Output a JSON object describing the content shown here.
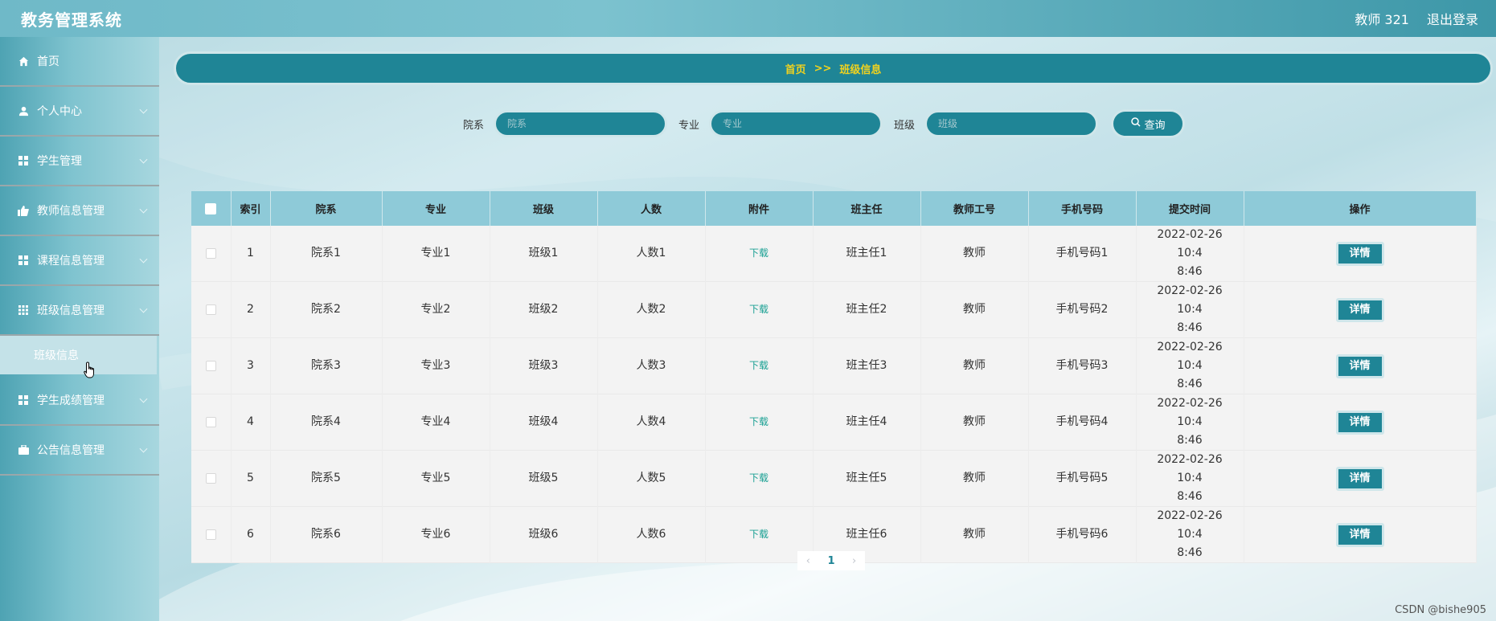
{
  "app": {
    "title": "教务管理系统"
  },
  "header": {
    "user_label": "教师 321",
    "logout_label": "退出登录"
  },
  "sidebar": {
    "items": [
      {
        "label": "首页",
        "icon": "home-icon",
        "expandable": false
      },
      {
        "label": "个人中心",
        "icon": "user-icon",
        "expandable": true
      },
      {
        "label": "学生管理",
        "icon": "grid-icon",
        "expandable": true
      },
      {
        "label": "教师信息管理",
        "icon": "thumbs-up-icon",
        "expandable": true
      },
      {
        "label": "课程信息管理",
        "icon": "grid-icon",
        "expandable": true
      },
      {
        "label": "班级信息管理",
        "icon": "table-icon",
        "expandable": true,
        "expanded": true
      },
      {
        "label": "学生成绩管理",
        "icon": "grid-icon",
        "expandable": true
      },
      {
        "label": "公告信息管理",
        "icon": "briefcase-icon",
        "expandable": true
      }
    ],
    "submenu": {
      "label": "班级信息"
    }
  },
  "breadcrumb": {
    "home": "首页",
    "separator": ">>",
    "current": "班级信息"
  },
  "search": {
    "dept_label": "院系",
    "dept_placeholder": "院系",
    "major_label": "专业",
    "major_placeholder": "专业",
    "class_label": "班级",
    "class_placeholder": "班级",
    "query_label": "查询"
  },
  "table": {
    "headers": [
      "索引",
      "院系",
      "专业",
      "班级",
      "人数",
      "附件",
      "班主任",
      "教师工号",
      "手机号码",
      "提交时间",
      "操作"
    ],
    "rows": [
      {
        "index": "1",
        "dept": "院系1",
        "major": "专业1",
        "class": "班级1",
        "count": "人数1",
        "attachment": "下载",
        "head_teacher": "班主任1",
        "teacher_id": "教师",
        "phone": "手机号码1",
        "time_line1": "2022-02-26 10:4",
        "time_line2": "8:46",
        "action": "详情"
      },
      {
        "index": "2",
        "dept": "院系2",
        "major": "专业2",
        "class": "班级2",
        "count": "人数2",
        "attachment": "下载",
        "head_teacher": "班主任2",
        "teacher_id": "教师",
        "phone": "手机号码2",
        "time_line1": "2022-02-26 10:4",
        "time_line2": "8:46",
        "action": "详情"
      },
      {
        "index": "3",
        "dept": "院系3",
        "major": "专业3",
        "class": "班级3",
        "count": "人数3",
        "attachment": "下载",
        "head_teacher": "班主任3",
        "teacher_id": "教师",
        "phone": "手机号码3",
        "time_line1": "2022-02-26 10:4",
        "time_line2": "8:46",
        "action": "详情"
      },
      {
        "index": "4",
        "dept": "院系4",
        "major": "专业4",
        "class": "班级4",
        "count": "人数4",
        "attachment": "下载",
        "head_teacher": "班主任4",
        "teacher_id": "教师",
        "phone": "手机号码4",
        "time_line1": "2022-02-26 10:4",
        "time_line2": "8:46",
        "action": "详情"
      },
      {
        "index": "5",
        "dept": "院系5",
        "major": "专业5",
        "class": "班级5",
        "count": "人数5",
        "attachment": "下载",
        "head_teacher": "班主任5",
        "teacher_id": "教师",
        "phone": "手机号码5",
        "time_line1": "2022-02-26 10:4",
        "time_line2": "8:46",
        "action": "详情"
      },
      {
        "index": "6",
        "dept": "院系6",
        "major": "专业6",
        "class": "班级6",
        "count": "人数6",
        "attachment": "下载",
        "head_teacher": "班主任6",
        "teacher_id": "教师",
        "phone": "手机号码6",
        "time_line1": "2022-02-26 10:4",
        "time_line2": "8:46",
        "action": "详情"
      }
    ]
  },
  "pagination": {
    "prev": "‹",
    "current_page": "1",
    "next": "›"
  },
  "watermark": "CSDN @bishe905",
  "colors": {
    "primary": "#1f8596",
    "accent_text": "#f0d21f",
    "table_header": "#8ecad8",
    "link": "#1aa093"
  }
}
